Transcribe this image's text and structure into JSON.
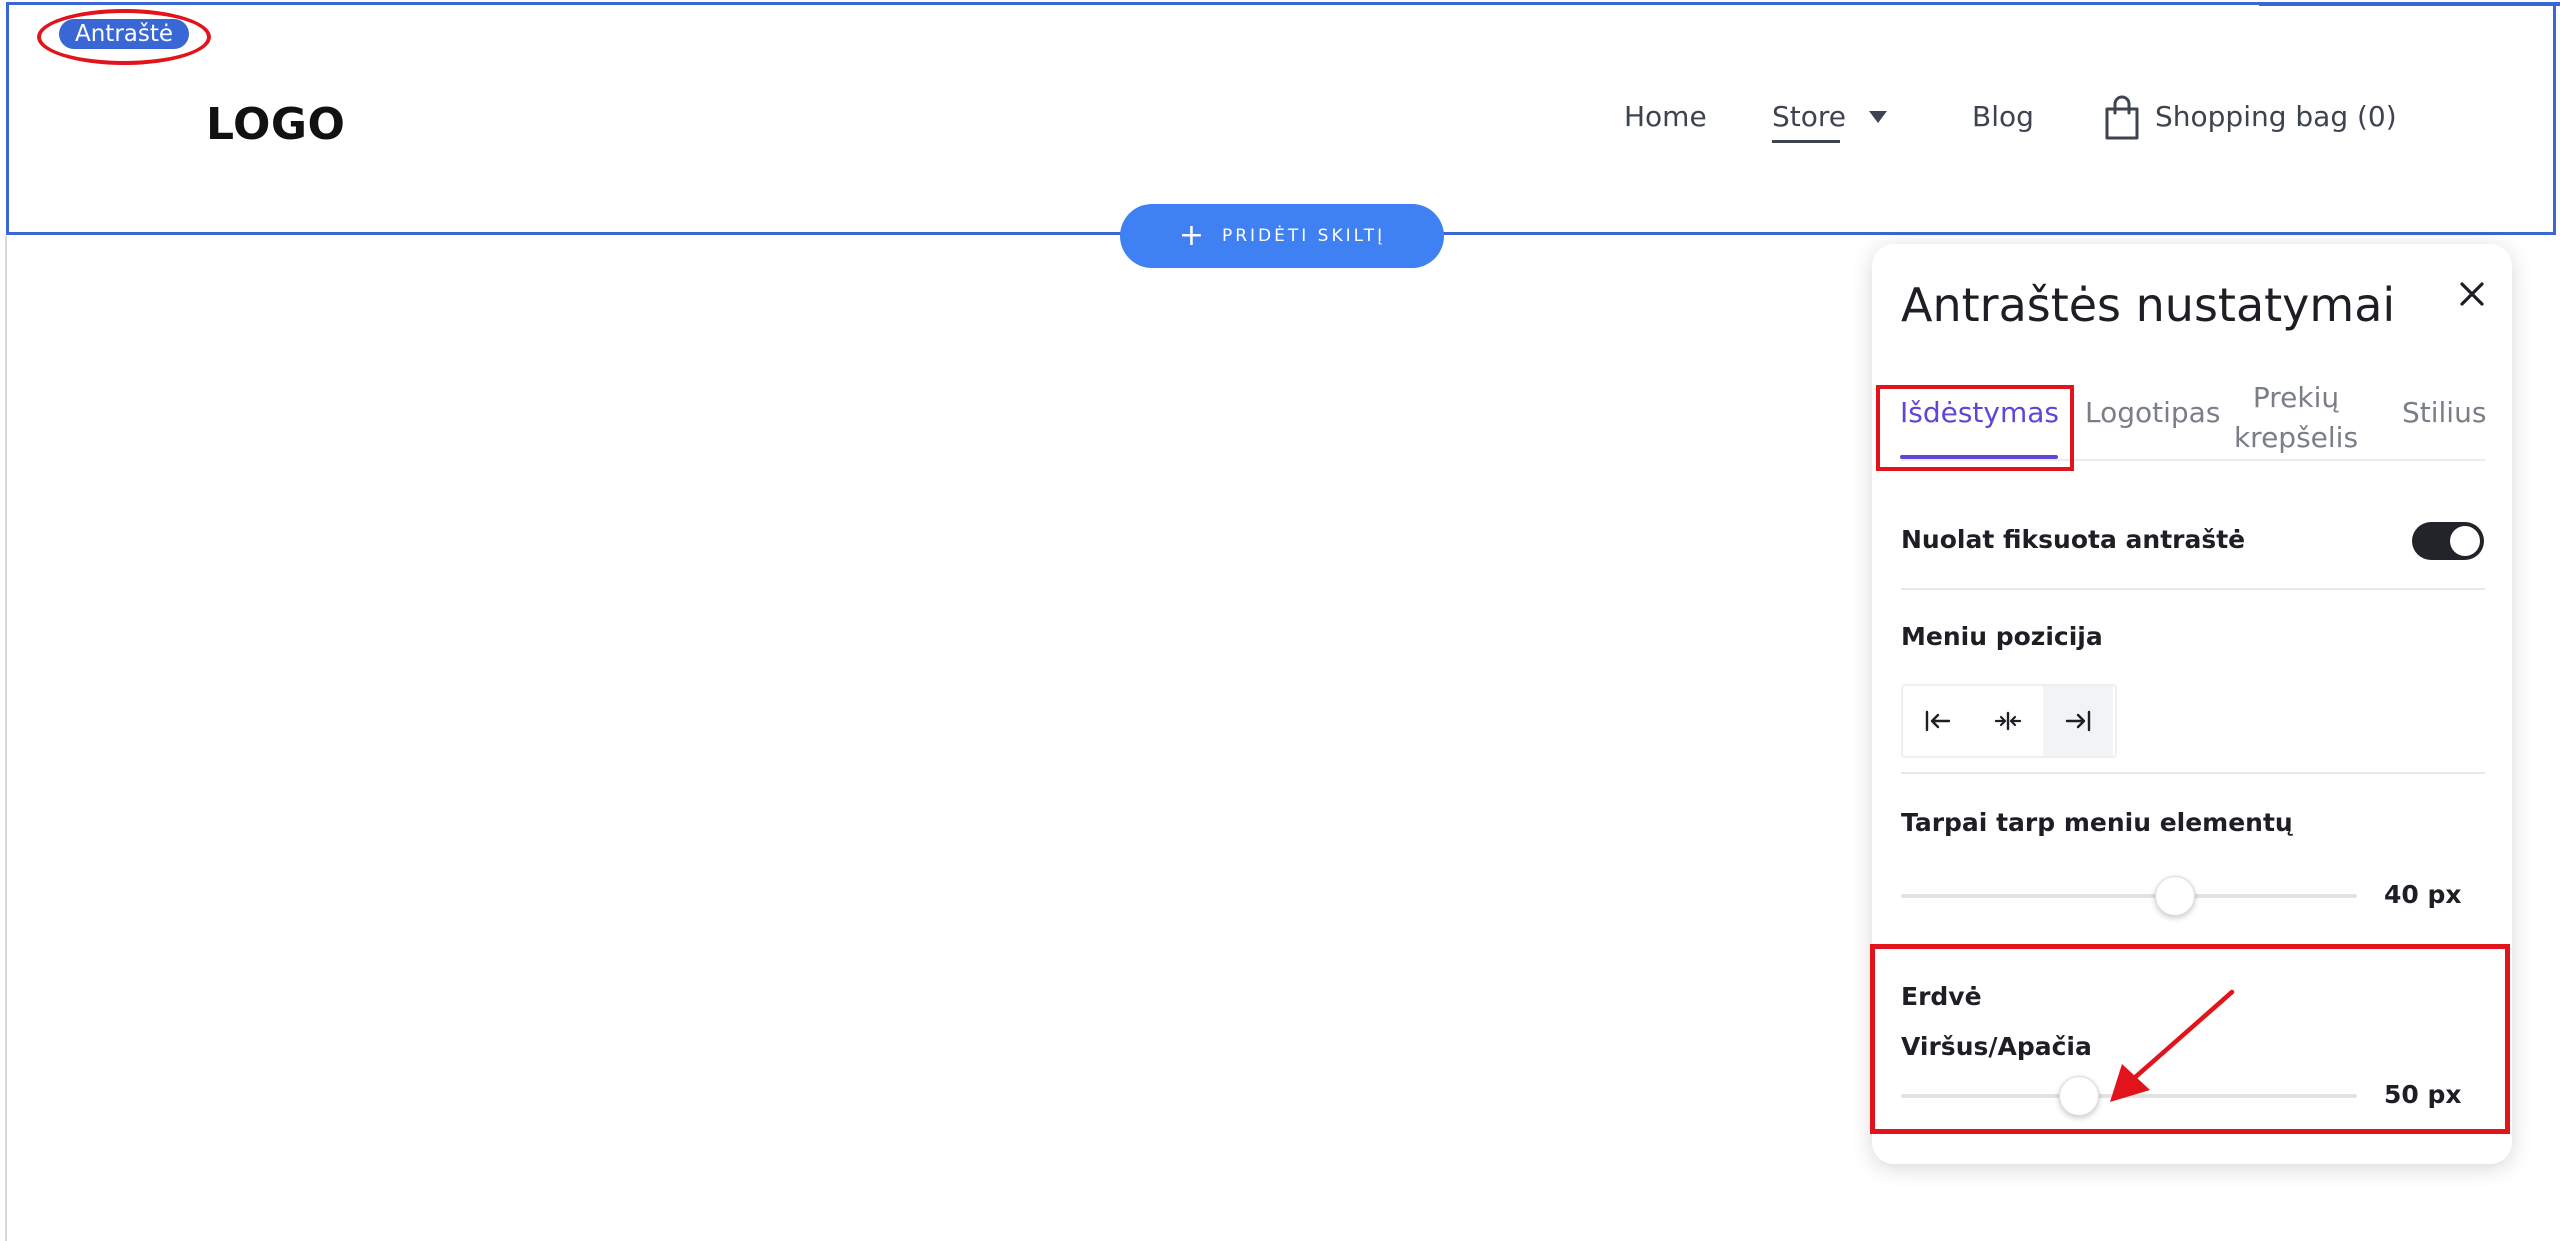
{
  "header": {
    "section_badge": "Antraštė",
    "logo": "LOGO",
    "nav": {
      "home": "Home",
      "store": "Store",
      "blog": "Blog",
      "shopping_bag": "Shopping bag (0)"
    }
  },
  "add_section": {
    "label": "PRIDĖTI SKILTĮ"
  },
  "panel": {
    "title": "Antraštės nustatymai",
    "tabs": [
      {
        "label": "Išdėstymas",
        "active": true
      },
      {
        "label": "Logotipas",
        "active": false
      },
      {
        "label": "Prekių krepšelis",
        "active": false
      },
      {
        "label": "Stilius",
        "active": false
      }
    ],
    "fixed_header": {
      "label": "Nuolat fiksuota antraštė",
      "enabled": true
    },
    "menu_position": {
      "label": "Meniu pozicija",
      "options": [
        "align-left-icon",
        "align-center-icon",
        "align-right-icon"
      ],
      "selected": "align-right-icon"
    },
    "menu_spacing": {
      "label": "Tarpai tarp meniu elementų",
      "value": 40,
      "display": "40 px",
      "fraction": 0.6
    },
    "space": {
      "label": "Erdvė",
      "sublabel": "Viršus/Apačia",
      "value": 50,
      "display": "50 px",
      "fraction": 0.39
    }
  },
  "colors": {
    "accent_blue": "#3a67d6",
    "button_blue": "#3f80f2",
    "active_tab": "#6244d8",
    "annotation_red": "#e3131b"
  }
}
